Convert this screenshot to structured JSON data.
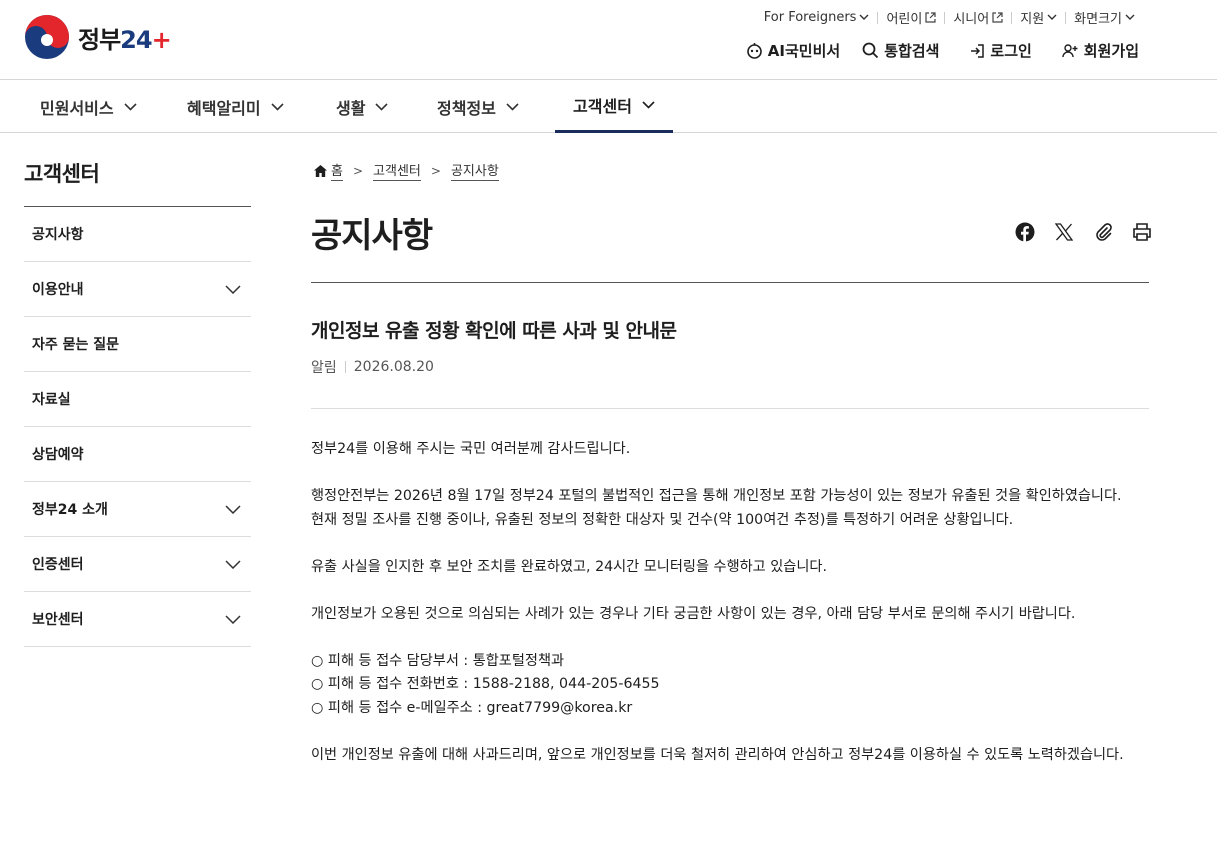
{
  "brand": {
    "name_prefix": "정부",
    "name_num": "2",
    "name_num2": "4"
  },
  "utility": {
    "items": [
      {
        "label": "For Foreigners",
        "icon": "chevron-down-icon"
      },
      {
        "label": "어린이",
        "icon": "external-link-icon"
      },
      {
        "label": "시니어",
        "icon": "external-link-icon"
      },
      {
        "label": "지원",
        "icon": "chevron-down-icon"
      },
      {
        "label": "화면크기",
        "icon": "chevron-down-icon"
      }
    ]
  },
  "gnb": {
    "ai": "AI국민비서",
    "search": "통합검색",
    "login": "로그인",
    "signup": "회원가입"
  },
  "nav": {
    "items": [
      {
        "label": "민원서비스"
      },
      {
        "label": "혜택알리미"
      },
      {
        "label": "생활"
      },
      {
        "label": "정책정보"
      },
      {
        "label": "고객센터"
      }
    ],
    "active_index": 4
  },
  "sidebar": {
    "title": "고객센터",
    "items": [
      {
        "label": "공지사항",
        "expandable": false
      },
      {
        "label": "이용안내",
        "expandable": true
      },
      {
        "label": "자주 묻는 질문",
        "expandable": false
      },
      {
        "label": "자료실",
        "expandable": false
      },
      {
        "label": "상담예약",
        "expandable": false
      },
      {
        "label": "정부24 소개",
        "expandable": true
      },
      {
        "label": "인증센터",
        "expandable": true
      },
      {
        "label": "보안센터",
        "expandable": true
      }
    ]
  },
  "breadcrumb": {
    "home": "홈",
    "level1": "고객센터",
    "level2": "공지사항"
  },
  "page": {
    "title": "공지사항"
  },
  "post": {
    "title": "개인정보 유출 정황 확인에 따른 사과 및 안내문",
    "category": "알림",
    "date": "2026.08.20",
    "lines": [
      "정부24를 이용해 주시는 국민 여러분께 감사드립니다.",
      "",
      "행정안전부는 2026년 8월 17일 정부24 포털의 불법적인 접근을 통해 개인정보 포함 가능성이 있는 정보가 유출된 것을 확인하였습니다.",
      "현재 정밀 조사를 진행 중이나, 유출된 정보의 정확한 대상자 및 건수(약 100여건 추정)를 특정하기 어려운 상황입니다.",
      "",
      "유출 사실을 인지한 후 보안 조치를 완료하였고, 24시간 모니터링을 수행하고 있습니다.",
      "",
      "개인정보가 오용된 것으로 의심되는 사례가 있는 경우나 기타 궁금한 사항이 있는 경우, 아래 담당 부서로 문의해 주시기 바랍니다.",
      "",
      "○ 피해 등 접수 담당부서 : 통합포털정책과",
      "○ 피해 등 접수 전화번호 : 1588-2188, 044-205-6455",
      "○ 피해 등 접수 e-메일주소 : great7799@korea.kr",
      "",
      "이번 개인정보 유출에 대해 사과드리며, 앞으로 개인정보를 더욱 철저히 관리하여 안심하고 정부24를 이용하실 수 있도록 노력하겠습니다."
    ]
  },
  "colors": {
    "accent": "#1a2c5b",
    "brand_red": "#e2262c",
    "brand_blue": "#1a3b7d"
  }
}
